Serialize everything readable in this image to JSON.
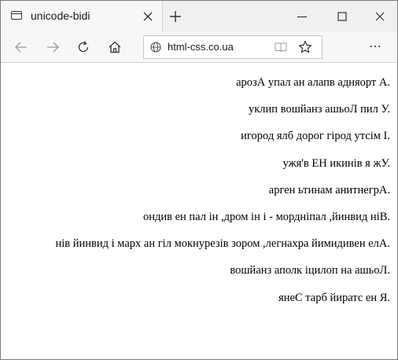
{
  "window": {
    "tab_title": "unicode-bidi"
  },
  "navbar": {
    "url": "html-css.co.ua"
  },
  "content": {
    "lines": [
      "арозА упал ан алапв адняорт А.",
      "уклип вошйанз ашьоЛ пил У.",
      "игород ялб дорог гірод утсім І.",
      "ужя'в ЕН икинів я жУ.",
      "арген ьтинам анитнегрА.",
      "ондив ен пал ін ,дром ін і - мордніпал ,йинвид ніВ.",
      "нів йинвид і марх ан гіл мокнурезів зором ,легнахра йимидивен елА.",
      "вошйанз аполк іцилоп на ашьоЛ.",
      "янеС тарб йиратс ен Я."
    ]
  }
}
